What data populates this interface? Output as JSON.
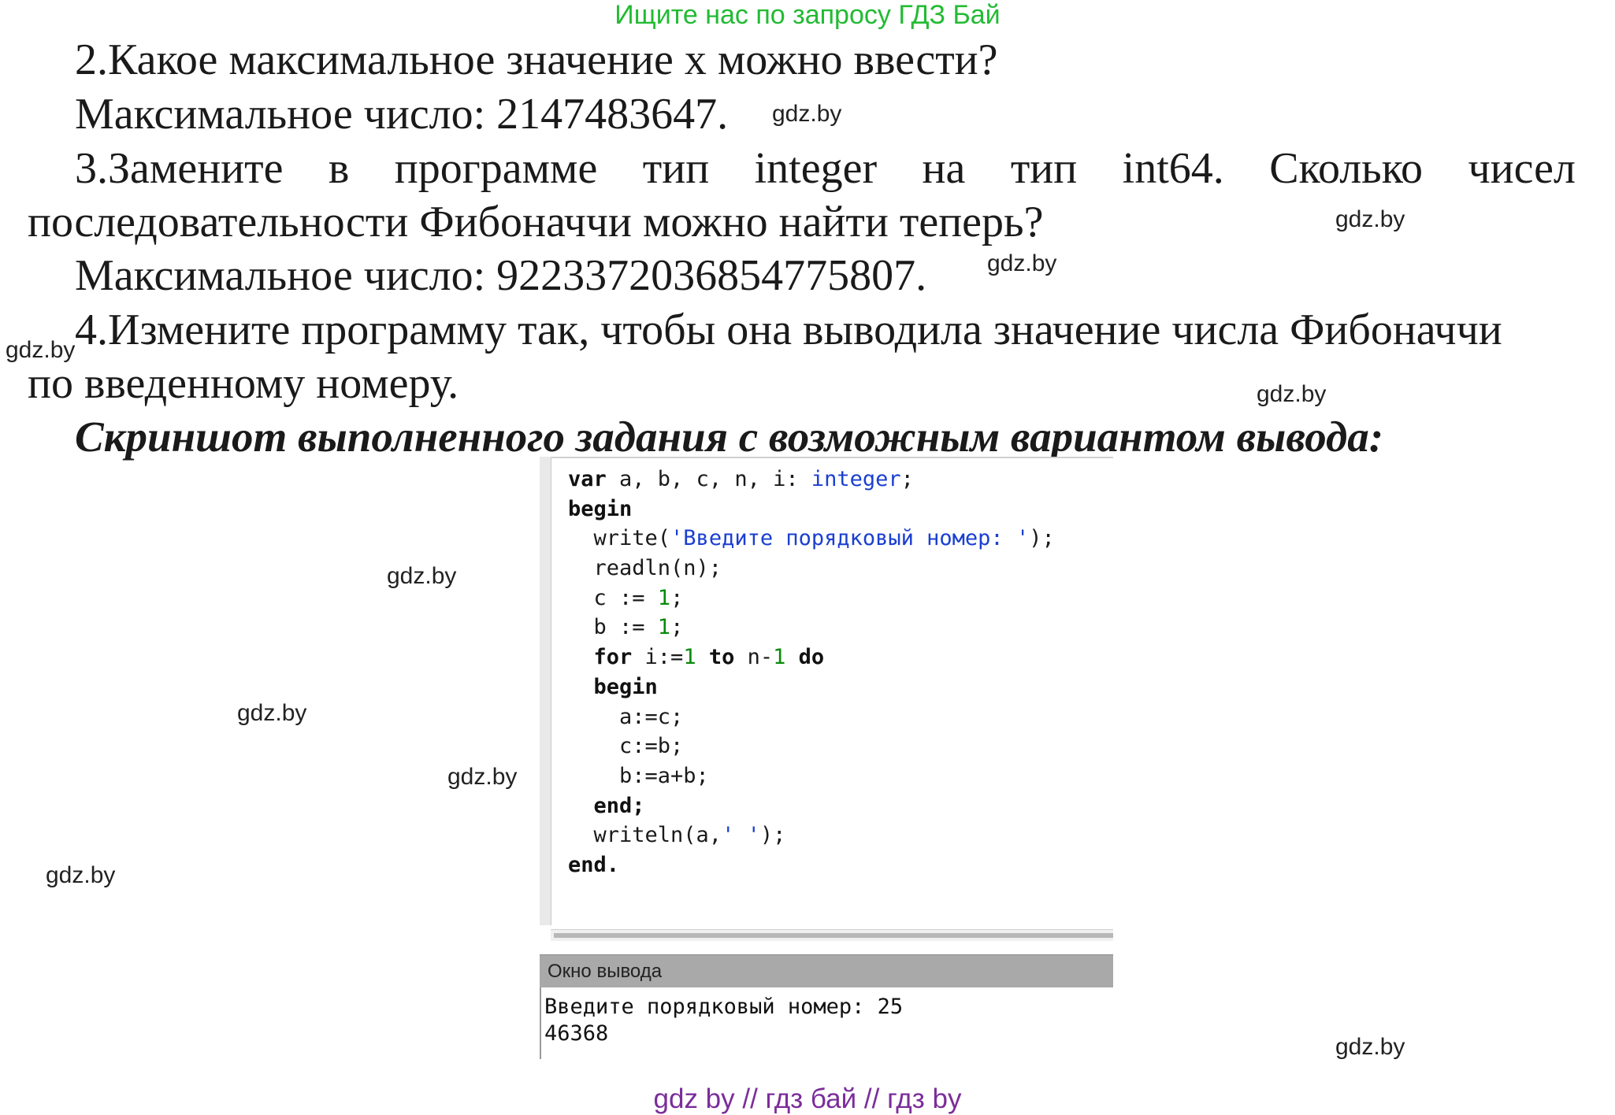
{
  "banner": "Ищите нас по запросу ГДЗ Бай",
  "lines": {
    "q2": "2.Какое максимальное значение х можно ввести?",
    "a2": "Максимальное число: 2147483647.",
    "q3_first_words": [
      "3.Замените",
      "в",
      "программе",
      "тип",
      "integer",
      "на",
      "тип",
      "int64.",
      "Сколько",
      "чисел"
    ],
    "q3_second": "последовательности Фибоначчи можно найти теперь?",
    "a3": "Максимальное число: 9223372036854775807.",
    "q4_first": "4.Измените программу так, чтобы она выводила значение числа Фибоначчи",
    "q4_second": "по введенному номеру.",
    "heading": "Скриншот выполненного задания с возможным вариантом вывода:"
  },
  "watermark": "gdz.by",
  "code": {
    "l1_var": "var",
    "l1_names": " a, b, c, n, i: ",
    "l1_type": "integer",
    "l1_end": ";",
    "l2": "begin",
    "l3_pre": "  write(",
    "l3_str": "'Введите порядковый номер: '",
    "l3_post": ");",
    "l4": "  readln(n);",
    "l5_pre": "  c := ",
    "l5_num": "1",
    "l5_post": ";",
    "l6_pre": "  b := ",
    "l6_num": "1",
    "l6_post": ";",
    "l7_for": "  for",
    "l7_a": " i:=",
    "l7_one": "1",
    "l7_sp": " ",
    "l7_to": "to",
    "l7_b": " n-",
    "l7_one2": "1",
    "l7_sp2": " ",
    "l7_do": "do",
    "l8": "  begin",
    "l9": "    a:=c;",
    "l10": "    c:=b;",
    "l11": "    b:=a+b;",
    "l12": "  end;",
    "l13_pre": "  writeln(a,",
    "l13_str": "' '",
    "l13_post": ");",
    "l14": "end."
  },
  "output": {
    "header": "Окно вывода",
    "line1": "Введите порядковый номер: 25",
    "line2": "46368"
  },
  "footer": "gdz by  //  гдз бай  //  гдз by"
}
